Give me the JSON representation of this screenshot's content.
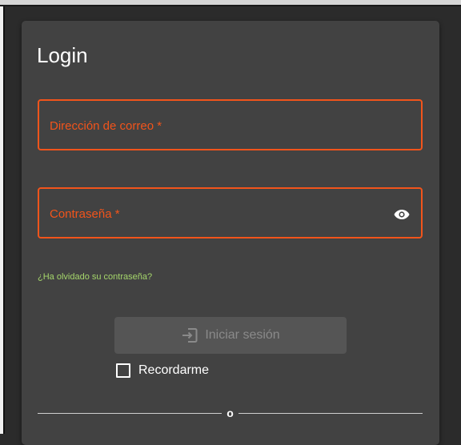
{
  "colors": {
    "accent": "#f2541b",
    "link": "#a5d66b",
    "card_bg": "#424242",
    "page_bg": "#2b2b2b",
    "button_disabled_bg": "#555555",
    "button_disabled_text": "#8a8a8a"
  },
  "login": {
    "title": "Login",
    "email_label": "Dirección de correo *",
    "password_label": "Contraseña *",
    "password_toggle_icon": "eye-icon",
    "forgot_password": "¿Ha olvidado su contraseña?",
    "submit_label": "Iniciar sesión",
    "submit_icon": "login-icon",
    "submit_disabled": true,
    "remember_label": "Recordarme",
    "remember_checked": false,
    "divider_text": "o"
  }
}
